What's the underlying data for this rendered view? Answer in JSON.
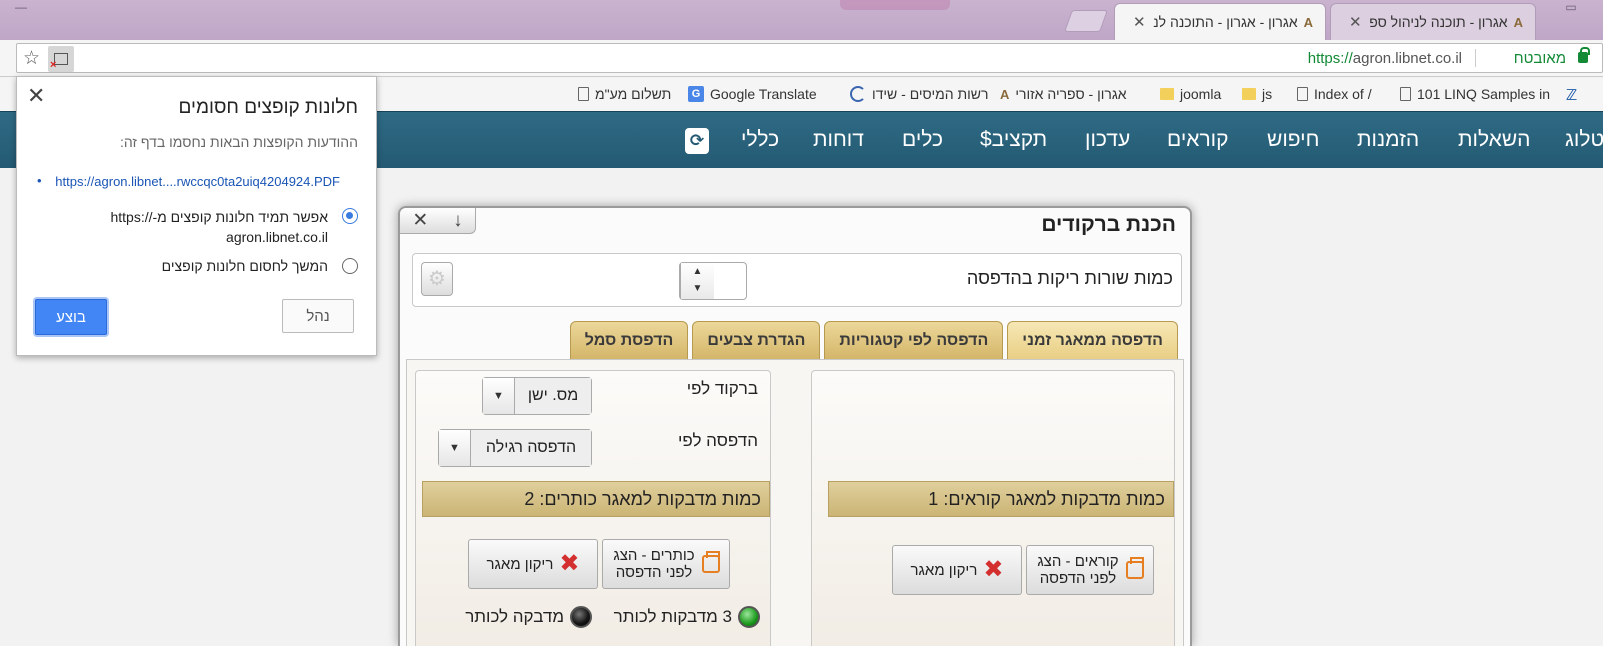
{
  "browser": {
    "tabs": [
      {
        "label": "אגרון - תוכנה לניהול ספ",
        "active": false
      },
      {
        "label": "אגרון - אגרון - התוכנה לנ",
        "active": true
      }
    ],
    "url_scheme": "https://",
    "url_host": "agron.libnet.co.il",
    "secure_label": "מאובטח"
  },
  "bookmarks": [
    {
      "label": "101 LINQ Samples in",
      "icon": "page-icon"
    },
    {
      "label": "Index of /",
      "icon": "page-icon"
    },
    {
      "label": "js",
      "icon": "folder-icon"
    },
    {
      "label": "joomla",
      "icon": "folder-icon"
    },
    {
      "label": "אגרון - ספריה אזורי",
      "icon": "agron-icon"
    },
    {
      "label": "רשות המיסים - שידו",
      "icon": "ring-icon"
    },
    {
      "label": "Google Translate",
      "icon": "google-translate-icon"
    },
    {
      "label": "תשלום מע\"מ",
      "icon": "page-icon"
    }
  ],
  "sitenav": {
    "items": [
      "קטלוג",
      "השאלות",
      "הזמנות",
      "חיפוש",
      "קוראים",
      "עדכון",
      "תקציב$",
      "כלים",
      "דוחות",
      "כללי"
    ]
  },
  "popup_blocked": {
    "title": "חלונות קופצים חסומים",
    "subtitle": "ההודעות הקופצות הבאות נחסמו בדף זה:",
    "link": "https://agron.libnet....rwccqc0ta2uiq4204924.PDF",
    "option_allow": "אפשר תמיד חלונות קופצים מ-https:// agron.libnet.co.il",
    "option_block": "המשך לחסום חלונות קופצים",
    "manage_label": "נהל",
    "done_label": "בוצע"
  },
  "dialog": {
    "title": "הכנת ברקודים",
    "empty_rows_label": "כמות שורות ריקות בהדפסה",
    "tabs": [
      "הדפסה ממאגר זמני",
      "הדפסה לפי קטגוריות",
      "הגדרת צבעים",
      "הדפסת סמל"
    ],
    "barcode_by_label": "ברקוד לפי",
    "barcode_by_value": "מס. ישן",
    "print_by_label": "הדפסה לפי",
    "print_by_value": "הדפסה רגילה",
    "titles_group": {
      "header": "כמות מדבקות למאגר כותרים: 2",
      "show_button": "כותרים - הצג לפני הדפסה",
      "clear_button": "ריקון מאגר",
      "led1_label": "3 מדבקות לכותר",
      "led2_label": "מדבקה לכותר"
    },
    "readers_group": {
      "header": "כמות מדבקות למאגר קוראים: 1",
      "show_button": "קוראים - הצג לפני הדפסה",
      "clear_button": "ריקון מאגר"
    }
  }
}
